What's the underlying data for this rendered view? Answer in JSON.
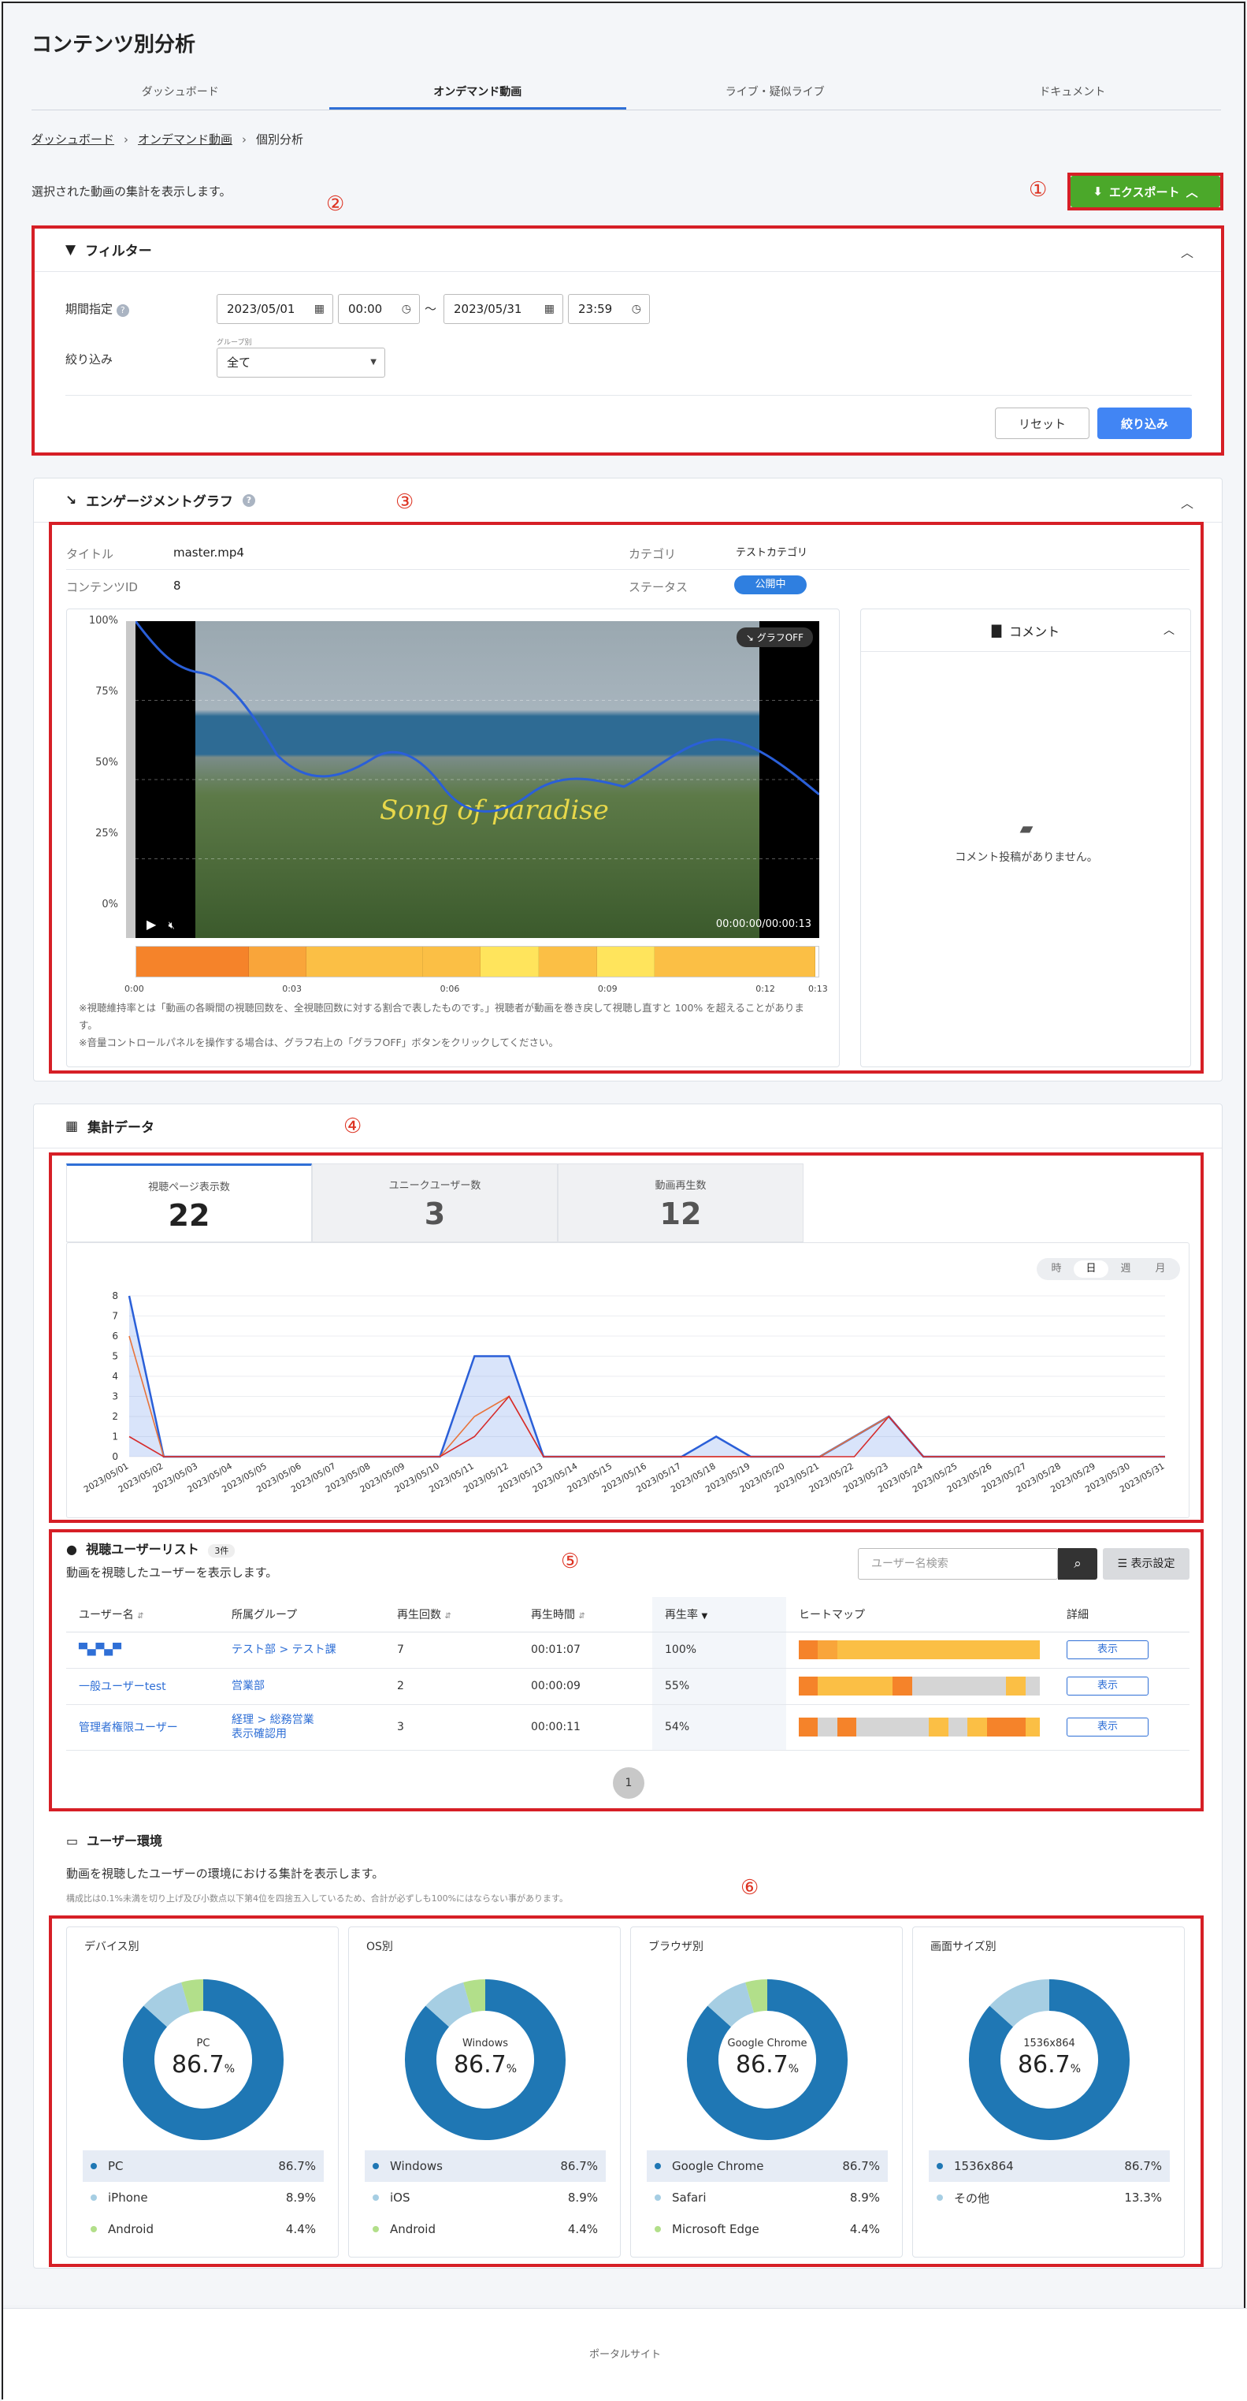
{
  "page": {
    "title": "コンテンツ別分析",
    "tabs": [
      "ダッシュボード",
      "オンデマンド動画",
      "ライブ・疑似ライブ",
      "ドキュメント"
    ],
    "active_tab": 1,
    "breadcrumb": [
      "ダッシュボード",
      "オンデマンド動画",
      "個別分析"
    ],
    "description": "選択された動画の集計を表示します。",
    "export_label": "エクスポート",
    "markers": [
      "①",
      "②",
      "③",
      "④",
      "⑤",
      "⑥"
    ]
  },
  "filter": {
    "title": "フィルター",
    "period_label": "期間指定",
    "start_date": "2023/05/01",
    "start_time": "00:00",
    "tilde": "～",
    "end_date": "2023/05/31",
    "end_time": "23:59",
    "narrow_label": "絞り込み",
    "group_caption": "グループ別",
    "group_value": "全て",
    "reset_label": "リセット",
    "apply_label": "絞り込み"
  },
  "engagement": {
    "title": "エンゲージメントグラフ",
    "title_label": "タイトル",
    "title_value": "master.mp4",
    "category_label": "カテゴリ",
    "category_value": "テストカテゴリ",
    "content_id_label": "コンテンツID",
    "content_id_value": "8",
    "status_label": "ステータス",
    "status_value": "公開中",
    "y_ticks": [
      "100%",
      "75%",
      "50%",
      "25%",
      "0%"
    ],
    "x_ticks": [
      "0:00",
      "0:03",
      "0:06",
      "0:09",
      "0:12",
      "0:13"
    ],
    "graph_off_label": "グラフOFF",
    "video_caption": "Song of paradise",
    "video_time": "00:00:00/00:00:13",
    "note1": "※視聴維持率とは「動画の各瞬間の視聴回数を、全視聴回数に対する割合で表したものです。」視聴者が動画を巻き戻して視聴し直すと 100% を超えることがあります。",
    "note2": "※音量コントロールパネルを操作する場合は、グラフ右上の「グラフOFF」ボタンをクリックしてください。",
    "comment_title": "コメント",
    "comment_empty": "コメント投稿がありません。",
    "heatmap": [
      {
        "w": 16.5,
        "c": "#f5832a"
      },
      {
        "w": 8.5,
        "c": "#f9a53a"
      },
      {
        "w": 17,
        "c": "#fbbf45"
      },
      {
        "w": 8.5,
        "c": "#fbbf45"
      },
      {
        "w": 8.5,
        "c": "#ffe45c"
      },
      {
        "w": 8.5,
        "c": "#fbbf45"
      },
      {
        "w": 8.5,
        "c": "#ffe45c"
      },
      {
        "w": 23.5,
        "c": "#fbbf45"
      }
    ]
  },
  "stats": {
    "title": "集計データ",
    "kpis": [
      {
        "label": "視聴ページ表示数",
        "value": "22"
      },
      {
        "label": "ユニークユーザー数",
        "value": "3"
      },
      {
        "label": "動画再生数",
        "value": "12"
      }
    ],
    "ranges": [
      "時",
      "日",
      "週",
      "月"
    ],
    "active_range": 1
  },
  "chart_data": {
    "type": "area",
    "title": "",
    "xlabel": "",
    "ylabel": "",
    "ylim": [
      0,
      8
    ],
    "y_ticks": [
      0,
      1,
      2,
      3,
      4,
      5,
      6,
      7,
      8
    ],
    "x": [
      "2023/05/01",
      "2023/05/02",
      "2023/05/03",
      "2023/05/04",
      "2023/05/05",
      "2023/05/06",
      "2023/05/07",
      "2023/05/08",
      "2023/05/09",
      "2023/05/10",
      "2023/05/11",
      "2023/05/12",
      "2023/05/13",
      "2023/05/14",
      "2023/05/15",
      "2023/05/16",
      "2023/05/17",
      "2023/05/18",
      "2023/05/19",
      "2023/05/20",
      "2023/05/21",
      "2023/05/22",
      "2023/05/23",
      "2023/05/24",
      "2023/05/25",
      "2023/05/26",
      "2023/05/27",
      "2023/05/28",
      "2023/05/29",
      "2023/05/30",
      "2023/05/31"
    ],
    "x_tick_labels": [
      "2023/05/01",
      "2023/05/02",
      "2023/05/03",
      "2023/05/04",
      "2023/05/05",
      "2023/05/06",
      "2023/05/07",
      "2023/05/08",
      "2023/05/09",
      "2023/05/10",
      "2023/05/11",
      "2023/05/12",
      "2023/05/13",
      "2023/05/14",
      "2023/05/15",
      "2023/05/16",
      "2023/05/17",
      "2023/05/18",
      "2023/05/19",
      "2023/05/20",
      "2023/05/21",
      "2023/05/22",
      "2023/05/23",
      "2023/05/24",
      "2023/05/25",
      "2023/05/26",
      "2023/05/27",
      "2023/05/28",
      "2023/05/29",
      "2023/05/30",
      "2023/05/31"
    ],
    "series": [
      {
        "values": [
          8,
          0,
          0,
          0,
          0,
          0,
          0,
          0,
          0,
          0,
          5,
          5,
          0,
          0,
          0,
          0,
          0,
          1,
          0,
          0,
          0,
          1,
          2,
          0,
          0,
          0,
          0,
          0,
          0,
          0,
          0
        ],
        "color": "#2a5fd8"
      },
      {
        "values": [
          6,
          0,
          0,
          0,
          0,
          0,
          0,
          0,
          0,
          0,
          2,
          3,
          0,
          0,
          0,
          0,
          0,
          0,
          0,
          0,
          0,
          1,
          2,
          0,
          0,
          0,
          0,
          0,
          0,
          0,
          0
        ],
        "color": "#e8733a"
      },
      {
        "values": [
          1,
          0,
          0,
          0,
          0,
          0,
          0,
          0,
          0,
          0,
          1,
          3,
          0,
          0,
          0,
          0,
          0,
          0,
          0,
          0,
          0,
          0,
          2,
          0,
          0,
          0,
          0,
          0,
          0,
          0,
          0
        ],
        "color": "#d62b2b"
      }
    ],
    "grid": true
  },
  "users": {
    "title": "視聴ユーザーリスト",
    "count_badge": "3件",
    "description": "動画を視聴したユーザーを表示します。",
    "search_placeholder": "ユーザー名検索",
    "display_settings": "表示設定",
    "columns": [
      "ユーザー名",
      "所属グループ",
      "再生回数",
      "再生時間",
      "再生率",
      "ヒートマップ",
      "詳細"
    ],
    "rows": [
      {
        "name": "▀▄▀▄▀",
        "group": "テスト部 > テスト課",
        "group2": "",
        "plays": "7",
        "time": "00:01:07",
        "rate": "100%",
        "heatmap": [
          {
            "w": 8,
            "c": "#f5832a"
          },
          {
            "w": 8,
            "c": "#f9a53a"
          },
          {
            "w": 84,
            "c": "#fbbf45"
          }
        ]
      },
      {
        "name": "一般ユーザーtest",
        "group": "営業部",
        "group2": "",
        "plays": "2",
        "time": "00:00:09",
        "rate": "55%",
        "heatmap": [
          {
            "w": 8,
            "c": "#f5832a"
          },
          {
            "w": 31,
            "c": "#fbbf45"
          },
          {
            "w": 8,
            "c": "#f5832a"
          },
          {
            "w": 39,
            "c": "#d5d5d5"
          },
          {
            "w": 8,
            "c": "#fbbf45"
          },
          {
            "w": 6,
            "c": "#d5d5d5"
          }
        ]
      },
      {
        "name": "管理者権限ユーザー",
        "group": "経理 > 総務営業",
        "group2": "表示確認用",
        "plays": "3",
        "time": "00:00:11",
        "rate": "54%",
        "heatmap": [
          {
            "w": 8,
            "c": "#f5832a"
          },
          {
            "w": 8,
            "c": "#d5d5d5"
          },
          {
            "w": 8,
            "c": "#f5832a"
          },
          {
            "w": 30,
            "c": "#d5d5d5"
          },
          {
            "w": 8,
            "c": "#fbbf45"
          },
          {
            "w": 8,
            "c": "#d5d5d5"
          },
          {
            "w": 8,
            "c": "#fbbf45"
          },
          {
            "w": 16,
            "c": "#f5832a"
          },
          {
            "w": 6,
            "c": "#fbbf45"
          }
        ]
      }
    ],
    "show_label": "表示",
    "page": "1"
  },
  "env": {
    "title": "ユーザー環境",
    "description": "動画を視聴したユーザーの環境における集計を表示します。",
    "note": "構成比は0.1%未満を切り上げ及び小数点以下第4位を四捨五入しているため、合計が必ずしも100%にはならない事があります。",
    "cards": [
      {
        "title": "デバイス別",
        "center_label": "PC",
        "center_value": "86.7",
        "unit": "%",
        "items": [
          {
            "name": "PC",
            "value": "86.7%",
            "color": "#1f77b4"
          },
          {
            "name": "iPhone",
            "value": "8.9%",
            "color": "#a6cee3"
          },
          {
            "name": "Android",
            "value": "4.4%",
            "color": "#b2df8a"
          }
        ]
      },
      {
        "title": "OS別",
        "center_label": "Windows",
        "center_value": "86.7",
        "unit": "%",
        "items": [
          {
            "name": "Windows",
            "value": "86.7%",
            "color": "#1f77b4"
          },
          {
            "name": "iOS",
            "value": "8.9%",
            "color": "#a6cee3"
          },
          {
            "name": "Android",
            "value": "4.4%",
            "color": "#b2df8a"
          }
        ]
      },
      {
        "title": "ブラウザ別",
        "center_label": "Google Chrome",
        "center_value": "86.7",
        "unit": "%",
        "items": [
          {
            "name": "Google Chrome",
            "value": "86.7%",
            "color": "#1f77b4"
          },
          {
            "name": "Safari",
            "value": "8.9%",
            "color": "#a6cee3"
          },
          {
            "name": "Microsoft Edge",
            "value": "4.4%",
            "color": "#b2df8a"
          }
        ]
      },
      {
        "title": "画面サイズ別",
        "center_label": "1536x864",
        "center_value": "86.7",
        "unit": "%",
        "items": [
          {
            "name": "1536x864",
            "value": "86.7%",
            "color": "#1f77b4"
          },
          {
            "name": "その他",
            "value": "13.3%",
            "color": "#a6cee3"
          }
        ]
      }
    ]
  },
  "footer": "ポータルサイト"
}
